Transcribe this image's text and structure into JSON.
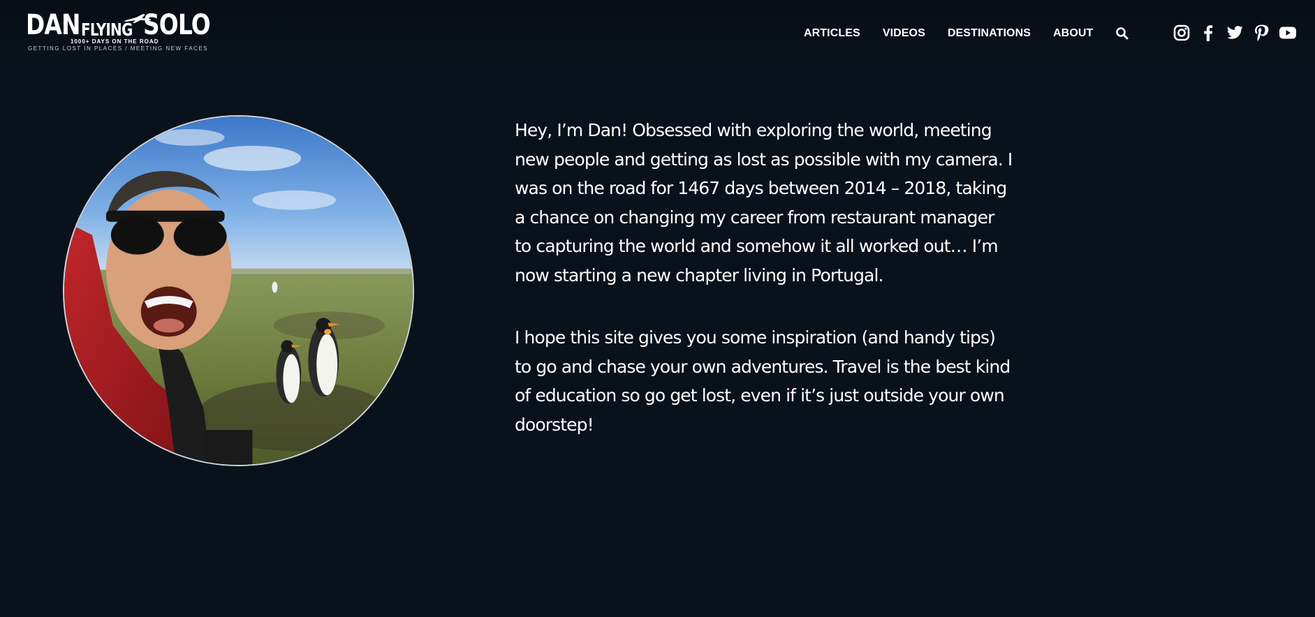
{
  "site": {
    "logo_dan": "DAN",
    "logo_flying": "FLYING",
    "logo_solo": "SOLO",
    "logo_days": "1000+ DAYS ON THE ROAD",
    "logo_tagline": "GETTING LOST IN PLACES / MEETING NEW FACES"
  },
  "nav": {
    "items": [
      {
        "label": "ARTICLES"
      },
      {
        "label": "VIDEOS"
      },
      {
        "label": "DESTINATIONS"
      },
      {
        "label": "ABOUT"
      }
    ],
    "search_icon": "search-icon"
  },
  "social": {
    "icons": [
      "instagram-icon",
      "facebook-icon",
      "twitter-icon",
      "pinterest-icon",
      "youtube-icon"
    ]
  },
  "bio": {
    "paragraph1": "Hey, I’m Dan! Obsessed with exploring the world, meeting new people and getting as lost as possible with my camera. I was on the road for 1467 days between 2014 – 2018, taking a chance on changing my career from restaurant manager to capturing the world and somehow it all worked out… I’m now starting a new chapter living in Portugal.",
    "paragraph2": "I hope this site gives you some inspiration (and handy tips) to go and chase your own adventures. Travel is the best kind of education so go get lost, even if it’s just outside your own doorstep!"
  },
  "colors": {
    "background": "#09111a",
    "text": "#ffffff"
  }
}
